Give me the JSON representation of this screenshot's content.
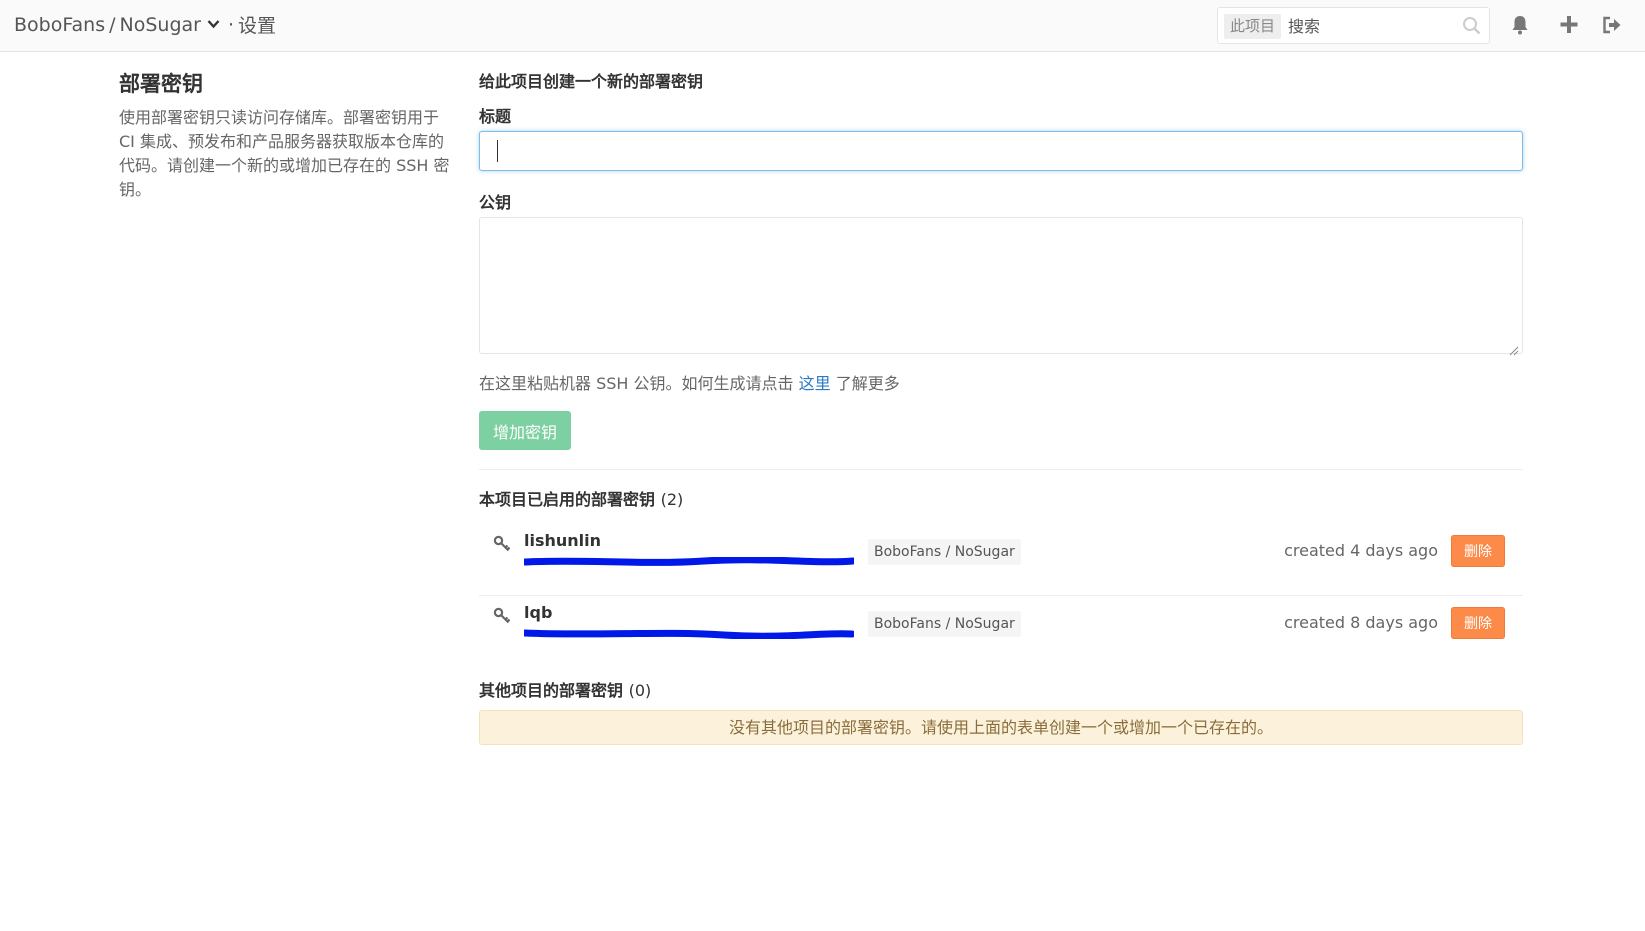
{
  "header": {
    "breadcrumb": {
      "namespace": "BoboFans",
      "separator": "/",
      "project": "NoSugar",
      "dot": "·",
      "page": "设置"
    },
    "search": {
      "scope_label": "此项目",
      "placeholder": "搜索"
    },
    "icons": [
      "bell-icon",
      "plus-icon",
      "sign-out-icon"
    ]
  },
  "left": {
    "title": "部署密钥",
    "description": "使用部署密钥只读访问存储库。部署密钥用于 CI 集成、预发布和产品服务器获取版本仓库的代码。请创建一个新的或增加已存在的 SSH 密钥。"
  },
  "form": {
    "heading": "给此项目创建一个新的部署密钥",
    "title_label": "标题",
    "title_value": "",
    "key_label": "公钥",
    "key_value": "",
    "help_prefix": "在这里粘贴机器 SSH 公钥。如何生成请点击",
    "help_link": "这里",
    "help_suffix": "了解更多",
    "submit_label": "增加密钥"
  },
  "enabled_keys": {
    "title": "本项目已启用的部署密钥",
    "count": "(2)",
    "items": [
      {
        "name": "lishunlin",
        "fingerprint": "",
        "project": "BoboFans / NoSugar",
        "created": "created 4 days ago",
        "delete_label": "删除"
      },
      {
        "name": "lqb",
        "fingerprint": "",
        "project": "BoboFans / NoSugar",
        "created": "created 8 days ago",
        "delete_label": "删除"
      }
    ]
  },
  "other_keys": {
    "title": "其他项目的部署密钥",
    "count": "(0)",
    "empty_message": "没有其他项目的部署密钥。请使用上面的表单创建一个或增加一个已存在的。"
  },
  "colors": {
    "add_button": "#7dd0a2",
    "delete_button": "#fc8b4a",
    "link": "#2b7ac4",
    "notice_bg": "#fcf2dc",
    "redaction": "#0018e8"
  }
}
